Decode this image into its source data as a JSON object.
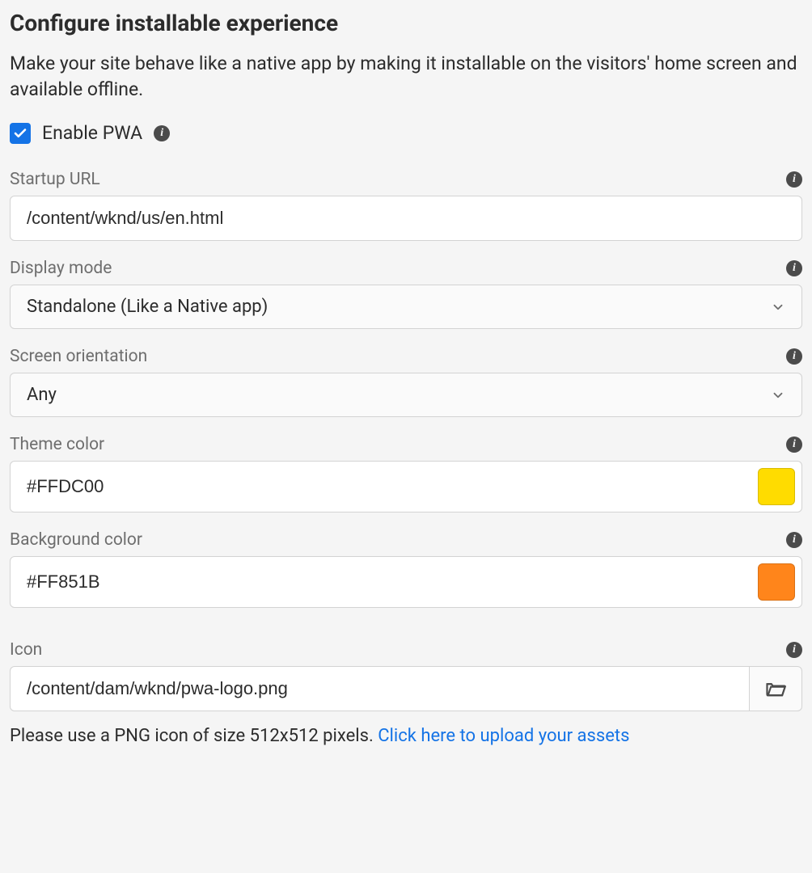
{
  "title": "Configure installable experience",
  "description": "Make your site behave like a native app by making it installable on the visitors' home screen and available offline.",
  "enable": {
    "label": "Enable PWA",
    "checked": true
  },
  "fields": {
    "startup_url": {
      "label": "Startup URL",
      "value": "/content/wknd/us/en.html"
    },
    "display_mode": {
      "label": "Display mode",
      "value": "Standalone (Like a Native app)"
    },
    "screen_orientation": {
      "label": "Screen orientation",
      "value": "Any"
    },
    "theme_color": {
      "label": "Theme color",
      "value": "#FFDC00",
      "swatch": "#FFDC00"
    },
    "background_color": {
      "label": "Background color",
      "value": "#FF851B",
      "swatch": "#FF851B"
    },
    "icon": {
      "label": "Icon",
      "value": "/content/dam/wknd/pwa-logo.png"
    }
  },
  "hint": {
    "prefix": "Please use a PNG icon of size 512x512 pixels. ",
    "link": "Click here to upload your assets"
  }
}
